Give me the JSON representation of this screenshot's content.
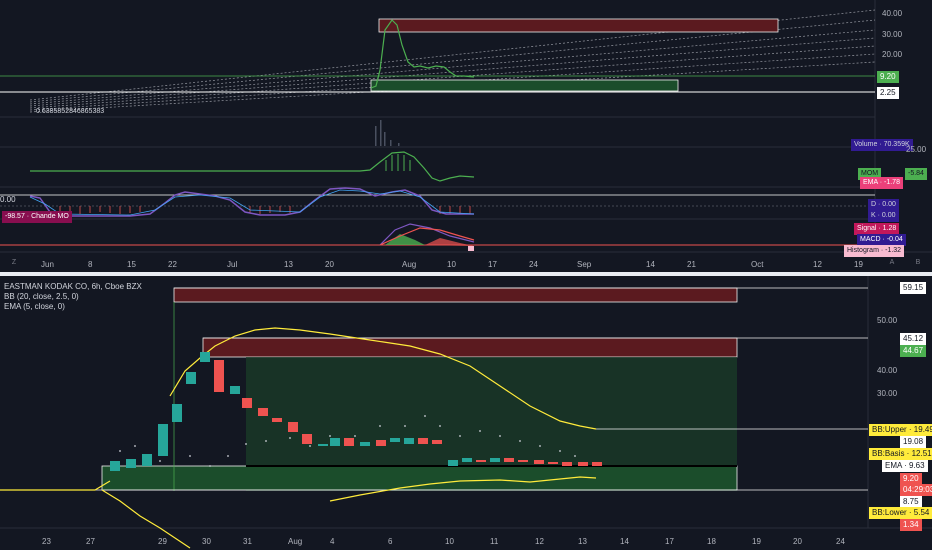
{
  "top": {
    "y_ticks": [
      "40.00",
      "30.00",
      "20.00"
    ],
    "price_labels": {
      "last": "9.20",
      "line": "2.25"
    },
    "fib_note": "0.6385852846865383",
    "volume_label": "Volume · 70.359K",
    "vol_scale": "25.00",
    "mom_label": "MOM",
    "mom_value": "-5.84",
    "ema_label": "EMA · -1.78",
    "stoch_scale": "0.00",
    "stoch_d": "D · 0.00",
    "stoch_k": "K · 0.00",
    "chande_label": "-98.57 · Chande MO",
    "macd_signal": "Signal · 1.28",
    "macd_value": "MACD · -0.04",
    "macd_hist": "Histogram · -1.32",
    "x_ticks": [
      "Jun",
      "8",
      "15",
      "22",
      "Jul",
      "13",
      "20",
      "Aug",
      "10",
      "17",
      "24",
      "Sep",
      "14",
      "21",
      "Oct",
      "12",
      "19"
    ],
    "axis_buttons": [
      "A",
      "B"
    ],
    "zoom_button": "Z"
  },
  "bottom": {
    "legend": {
      "symbol": "EASTMAN KODAK CO, 6h, Cboe BZX",
      "bb": "BB (20, close, 2.5, 0)",
      "ema": "EMA (5, close, 0)"
    },
    "y_ticks": [
      "50.00",
      "40.00",
      "30.00"
    ],
    "labels": {
      "top_box": "59.15",
      "upper_box": "45.12",
      "upper_box2": "44.67",
      "bb_upper": "BB:Upper · 19.49",
      "line_19": "19.08",
      "bb_basis": "BB:Basis · 12.51",
      "ema": "EMA · 9.63",
      "price": "9.20",
      "countdown": "04:29:03",
      "line_875": "8.75",
      "bb_lower": "BB:Lower · 5.54",
      "bottom_val": "1.34"
    },
    "x_ticks": [
      "23",
      "27",
      "29",
      "30",
      "31",
      "Aug",
      "4",
      "6",
      "10",
      "11",
      "12",
      "13",
      "14",
      "17",
      "18",
      "19",
      "20",
      "24"
    ]
  },
  "colors": {
    "bg": "#131722",
    "up": "#26a69a",
    "down": "#ef5350",
    "bb_yellow": "#ffeb3b",
    "box_red": "#5b1a1f",
    "box_green": "#1b4d2b",
    "mom_green": "#4caf50",
    "purple": "#7e57c2"
  }
}
